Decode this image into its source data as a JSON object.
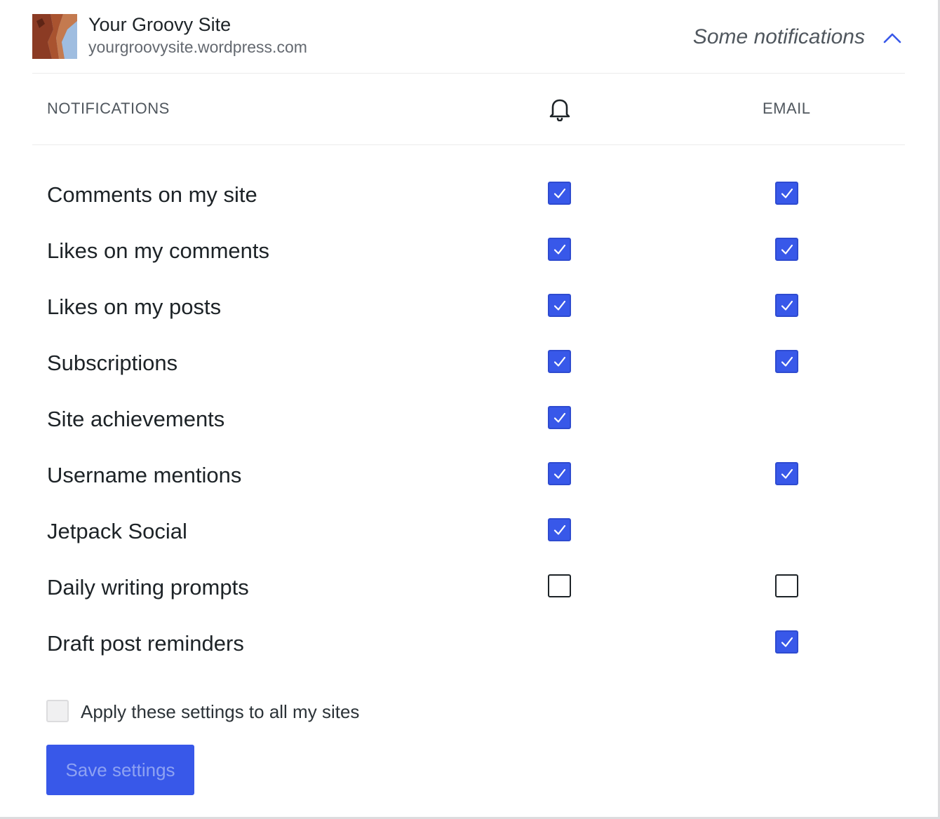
{
  "site": {
    "name": "Your Groovy Site",
    "url": "yourgroovysite.wordpress.com",
    "summary": "Some notifications"
  },
  "columns": {
    "notifications": "NOTIFICATIONS",
    "push_icon": "bell-icon",
    "email": "EMAIL"
  },
  "rows": [
    {
      "label": "Comments on my site",
      "push": "checked",
      "email": "checked"
    },
    {
      "label": "Likes on my comments",
      "push": "checked",
      "email": "checked"
    },
    {
      "label": "Likes on my posts",
      "push": "checked",
      "email": "checked"
    },
    {
      "label": "Subscriptions",
      "push": "checked",
      "email": "checked"
    },
    {
      "label": "Site achievements",
      "push": "checked",
      "email": "none"
    },
    {
      "label": "Username mentions",
      "push": "checked",
      "email": "checked"
    },
    {
      "label": "Jetpack Social",
      "push": "checked",
      "email": "none"
    },
    {
      "label": "Daily writing prompts",
      "push": "unchecked",
      "email": "unchecked"
    },
    {
      "label": "Draft post reminders",
      "push": "none",
      "email": "checked"
    }
  ],
  "apply_all": {
    "label": "Apply these settings to all my sites",
    "checked": false
  },
  "save_button": {
    "label": "Save settings",
    "enabled": false
  },
  "colors": {
    "accent": "#3858e9",
    "text": "#1d2327",
    "muted": "#646970"
  }
}
